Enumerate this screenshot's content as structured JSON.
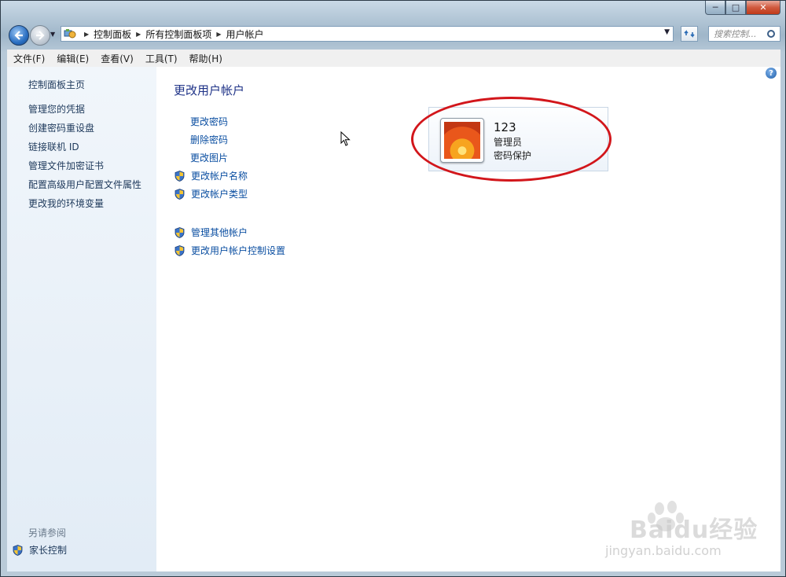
{
  "window": {
    "caption": {
      "minimize": "─",
      "maximize": "□",
      "close": "✕"
    }
  },
  "address": {
    "breadcrumbs": [
      "控制面板",
      "所有控制面板项",
      "用户帐户"
    ],
    "search_placeholder": "搜索控制..."
  },
  "menu": [
    "文件(F)",
    "编辑(E)",
    "查看(V)",
    "工具(T)",
    "帮助(H)"
  ],
  "sidebar": {
    "home": "控制面板主页",
    "tasks": [
      "管理您的凭据",
      "创建密码重设盘",
      "链接联机 ID",
      "管理文件加密证书",
      "配置高级用户配置文件属性",
      "更改我的环境变量"
    ],
    "see_also": "另请参阅",
    "parental": "家长控制"
  },
  "main": {
    "title": "更改用户帐户",
    "links": [
      {
        "label": "更改密码",
        "shield": false
      },
      {
        "label": "删除密码",
        "shield": false
      },
      {
        "label": "更改图片",
        "shield": false
      },
      {
        "label": "更改帐户名称",
        "shield": true
      },
      {
        "label": "更改帐户类型",
        "shield": true
      }
    ],
    "links2": [
      {
        "label": "管理其他帐户",
        "shield": true
      },
      {
        "label": "更改用户帐户控制设置",
        "shield": true
      }
    ]
  },
  "account": {
    "name": "123",
    "role": "管理员",
    "protection": "密码保护"
  },
  "help_icon": "?",
  "watermark": {
    "brand": "Baidu经验",
    "url": "jingyan.baidu.com"
  },
  "colors": {
    "link": "#0a4ea1",
    "title": "#1e3287",
    "highlight_ellipse": "#d2161b"
  }
}
